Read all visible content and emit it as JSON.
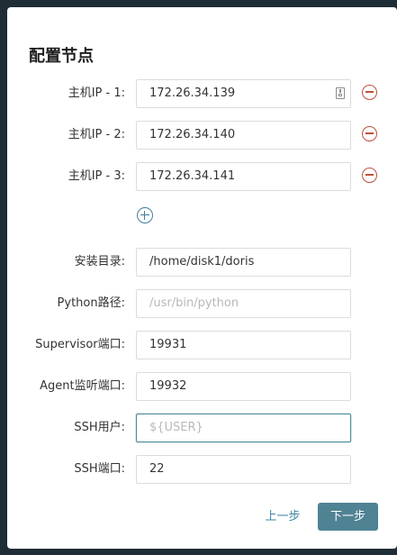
{
  "dialog": {
    "title": "配置节点"
  },
  "hosts": [
    {
      "label": "主机IP - 1:",
      "value": "172.26.34.139"
    },
    {
      "label": "主机IP - 2:",
      "value": "172.26.34.140"
    },
    {
      "label": "主机IP - 3:",
      "value": "172.26.34.141"
    }
  ],
  "fields": {
    "install_dir": {
      "label": "安装目录:",
      "value": "/home/disk1/doris"
    },
    "python_path": {
      "label": "Python路径:",
      "placeholder": "/usr/bin/python"
    },
    "supervisor_port": {
      "label": "Supervisor端口:",
      "value": "19931"
    },
    "agent_port": {
      "label": "Agent监听端口:",
      "value": "19932"
    },
    "ssh_user": {
      "label": "SSH用户:",
      "placeholder": "${USER}"
    },
    "ssh_port": {
      "label": "SSH端口:",
      "value": "22"
    }
  },
  "footer": {
    "prev_label": "上一步",
    "next_label": "下一步"
  },
  "colors": {
    "remove_icon": "#c0503a",
    "add_icon": "#3f7ea0",
    "primary_button": "#4f8293",
    "focus_border": "#4a8a9a",
    "backdrop": "#1f2d36"
  },
  "icons": {
    "host_remove": "minus-circle-icon",
    "host_add": "plus-circle-icon",
    "autofill": "autofill-icon"
  }
}
